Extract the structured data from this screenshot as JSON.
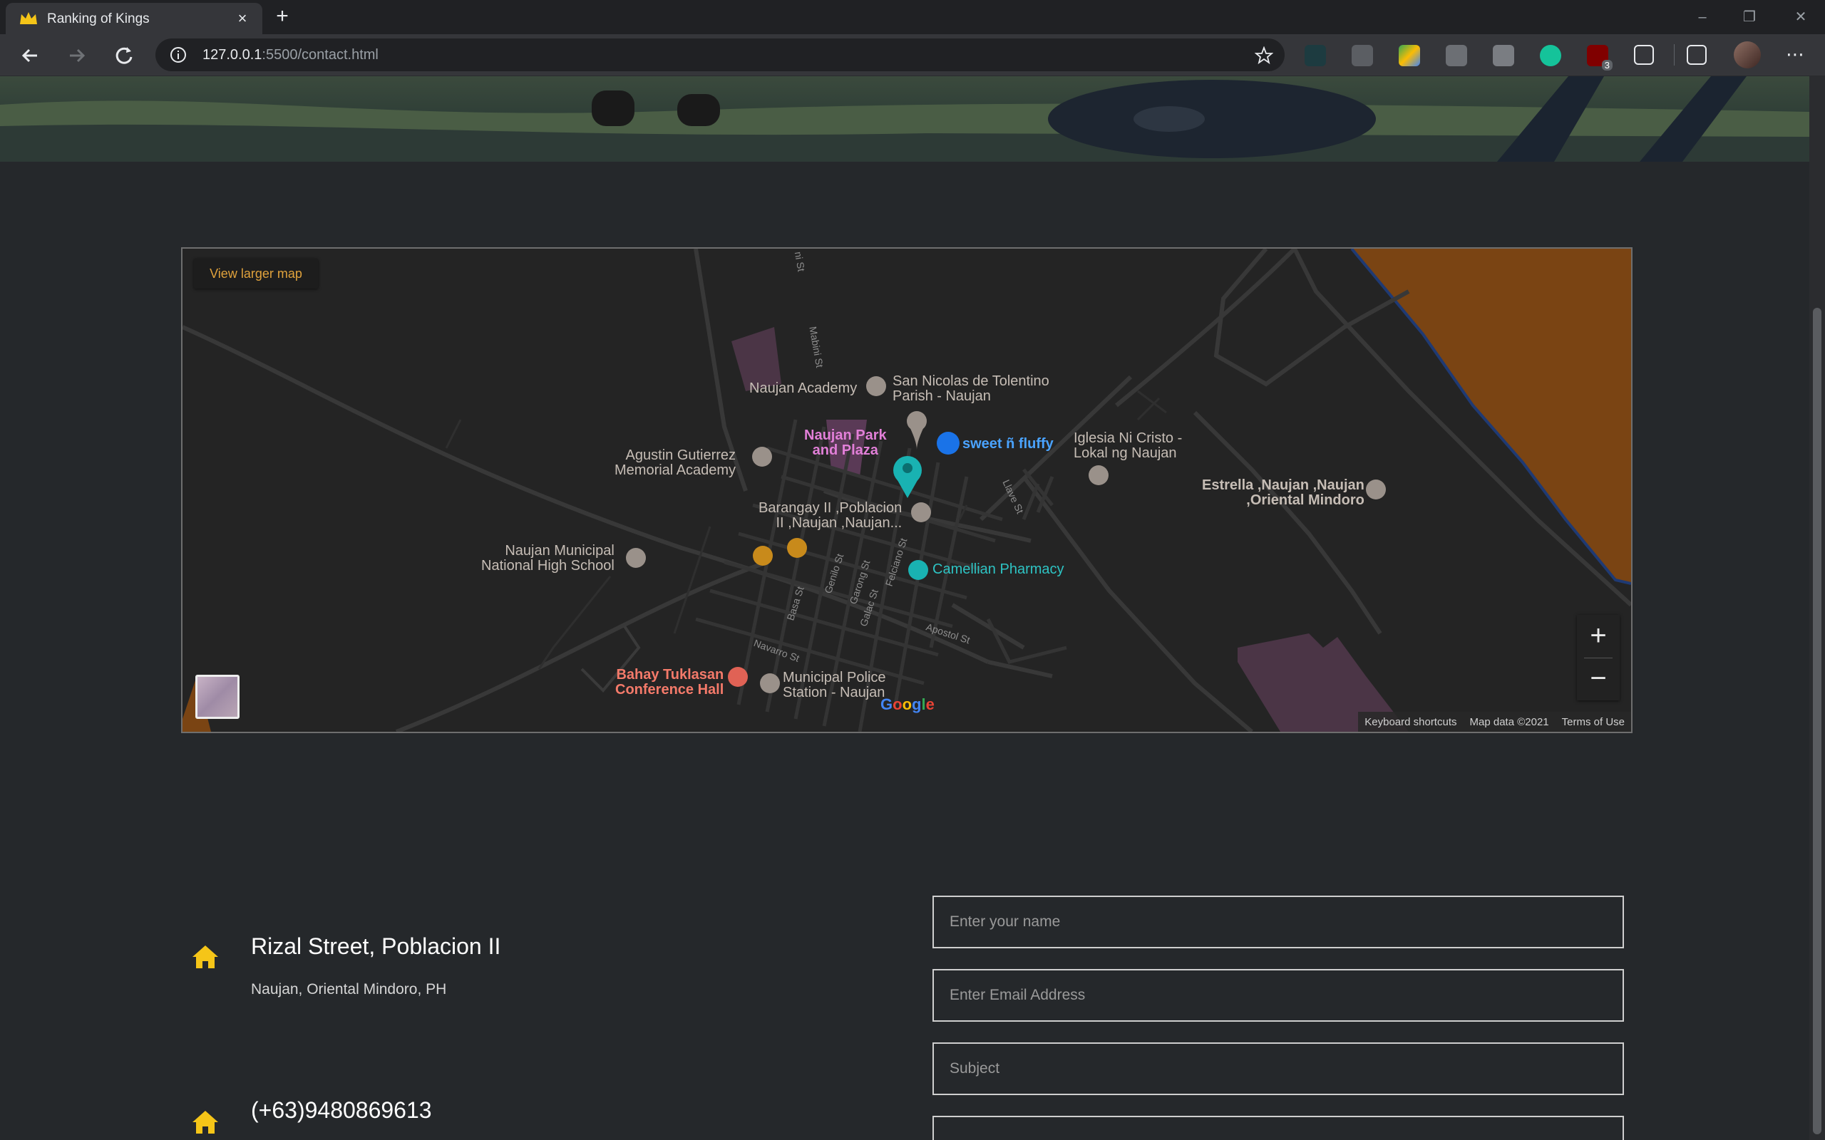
{
  "browser": {
    "tab_title": "Ranking of Kings",
    "url_host": "127.0.0.1",
    "url_rest": ":5500/contact.html",
    "ext_badge": "3"
  },
  "map": {
    "view_larger": "View larger map",
    "zoom_in": "+",
    "zoom_out": "−",
    "footer": {
      "shortcuts": "Keyboard shortcuts",
      "mapdata": "Map data ©2021",
      "terms": "Terms of Use"
    },
    "google": "Google",
    "places": [
      {
        "name": "Naujan Academy"
      },
      {
        "name": "San Nicolas de Tolentino",
        "line2": "Parish - Naujan"
      },
      {
        "name": "Naujan Park",
        "line2": "and Plaza"
      },
      {
        "name": "sweet ñ fluffy"
      },
      {
        "name": "Iglesia Ni Cristo -",
        "line2": "Lokal ng Naujan"
      },
      {
        "name": "Agustin Gutierrez",
        "line2": "Memorial Academy"
      },
      {
        "name": "Estrella ,Naujan ,Naujan",
        "line2": ",Oriental Mindoro"
      },
      {
        "name": "Barangay II ,Poblacion",
        "line2": "II ,Naujan ,Naujan..."
      },
      {
        "name": "Naujan Municipal",
        "line2": "National High School"
      },
      {
        "name": "Camellian Pharmacy"
      },
      {
        "name": "Bahay Tuklasan",
        "line2": "Conference Hall"
      },
      {
        "name": "Municipal Police",
        "line2": "Station - Naujan"
      }
    ],
    "streets": [
      "Mabini St",
      "Llave St",
      "Basa St",
      "Genilo St",
      "Garong St",
      "Felciano St",
      "Galac St",
      "Apostol St",
      "Navarro St",
      "ni St"
    ]
  },
  "contact": {
    "address_title": "Rizal Street, Poblacion II",
    "address_sub": "Naujan, Oriental Mindoro, PH",
    "phone_title": "(+63)9480869613",
    "form": {
      "name_placeholder": "Enter your name",
      "email_placeholder": "Enter Email Address",
      "subject_placeholder": "Subject"
    }
  },
  "colors": {
    "page_bg": "#25282b",
    "accent_yellow": "#f5c518",
    "map_bg": "#242424",
    "link_orange": "#e0a23c"
  }
}
